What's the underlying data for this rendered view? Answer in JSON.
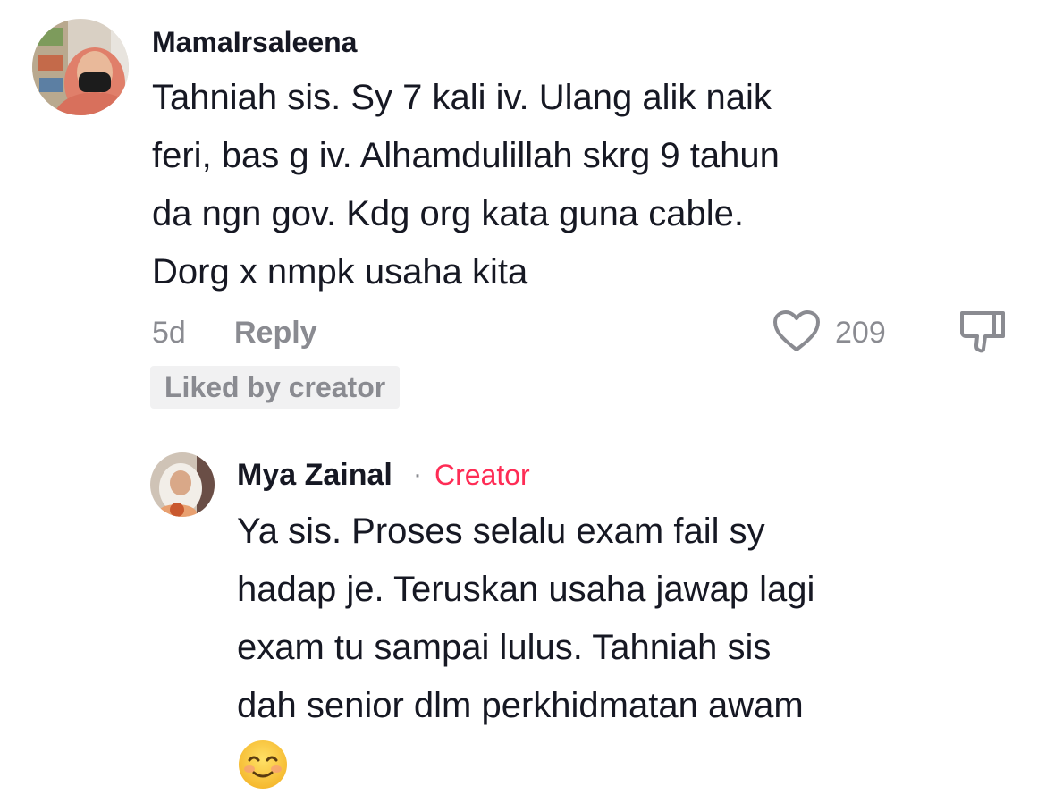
{
  "comments": [
    {
      "username": "MamaIrsaleena",
      "text_lines": [
        "Tahniah sis. Sy 7 kali iv. Ulang alik naik",
        "feri, bas g iv. Alhamdulillah skrg 9 tahun",
        "da ngn gov. Kdg org kata guna cable.",
        "Dorg x nmpk usaha kita"
      ],
      "age": "5d",
      "reply_label": "Reply",
      "like_count": "209",
      "badge": "Liked by creator"
    }
  ],
  "reply": {
    "username": "Mya Zainal",
    "separator": "·",
    "role": "Creator",
    "text_lines": [
      "Ya sis. Proses selalu exam fail sy",
      "hadap je. Teruskan usaha jawap lagi",
      "exam tu sampai lulus. Tahniah sis",
      "dah senior dlm perkhidmatan awam"
    ],
    "emoji_icon": "smiling-face-emoji"
  },
  "colors": {
    "text": "#161823",
    "secondary": "#8a8b91",
    "creator_accent": "#fe2c55",
    "badge_bg": "#f1f1f2"
  },
  "icons": {
    "like": "heart-outline-icon",
    "dislike": "thumbs-down-icon"
  }
}
